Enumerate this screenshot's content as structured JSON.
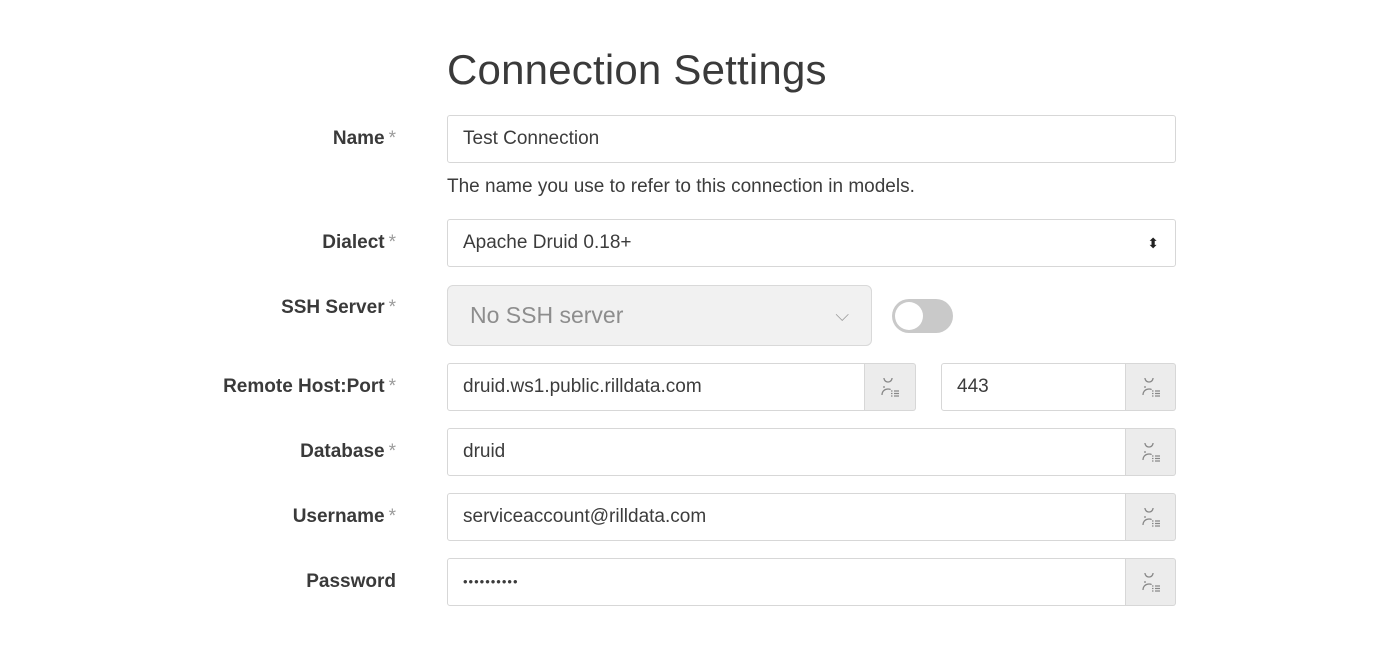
{
  "page": {
    "title": "Connection Settings"
  },
  "form": {
    "required_marker": "*",
    "name": {
      "label": "Name",
      "value": "Test Connection",
      "help": "The name you use to refer to this connection in models."
    },
    "dialect": {
      "label": "Dialect",
      "value": "Apache Druid 0.18+",
      "arrow_glyph": "⬍"
    },
    "ssh_server": {
      "label": "SSH Server",
      "value": "No SSH server",
      "chevron_glyph": "⌵",
      "toggle_on": false
    },
    "remote_host_port": {
      "label": "Remote Host:Port",
      "host": "druid.ws1.public.rilldata.com",
      "port": "443"
    },
    "database": {
      "label": "Database",
      "value": "druid"
    },
    "username": {
      "label": "Username",
      "value": "serviceaccount@rilldata.com"
    },
    "password": {
      "label": "Password",
      "value": "••••••••••"
    }
  },
  "icons": {
    "variable_icon": "user-variable-icon"
  },
  "colors": {
    "addon_bg": "#ececec",
    "toggle_off": "#c9c9c9",
    "border": "#d7d7d7"
  }
}
